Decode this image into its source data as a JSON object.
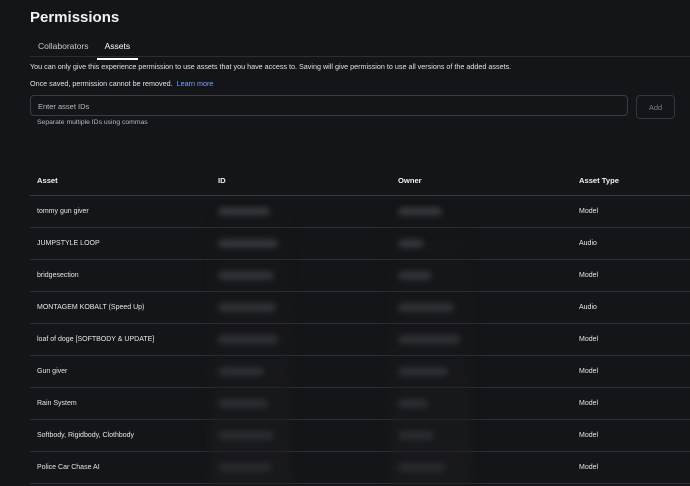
{
  "header": {
    "title": "Permissions"
  },
  "tabs": [
    {
      "label": "Collaborators",
      "active": false
    },
    {
      "label": "Assets",
      "active": true
    }
  ],
  "description": {
    "line1": "You can only give this experience permission to use assets that you have access to. Saving will give permission to use all versions of the added assets.",
    "line2": "Once saved, permission cannot be removed.",
    "learn_more": "Learn more"
  },
  "input": {
    "placeholder": "Enter asset IDs",
    "value": "",
    "hint": "Separate multiple IDs using commas"
  },
  "add_button": {
    "label": "Add",
    "disabled": true
  },
  "table": {
    "columns": [
      "Asset",
      "ID",
      "Owner",
      "Asset Type"
    ],
    "rows": [
      {
        "asset": "tommy gun giver",
        "type": "Model"
      },
      {
        "asset": "JUMPSTYLE LOOP",
        "type": "Audio"
      },
      {
        "asset": "bridgesection",
        "type": "Model"
      },
      {
        "asset": "MONTAGEM KOBALT (Speed Up)",
        "type": "Audio"
      },
      {
        "asset": "loaf of doge [SOFTBODY & UPDATE]",
        "type": "Model"
      },
      {
        "asset": "Gun giver",
        "type": "Model"
      },
      {
        "asset": "Rain System",
        "type": "Model"
      },
      {
        "asset": "Softbody, Rigidbody, Clothbody",
        "type": "Model"
      },
      {
        "asset": "Police Car Chase AI",
        "type": "Model"
      }
    ]
  },
  "colors": {
    "background": "#141518",
    "link": "#7aa5ff",
    "divider": "#2c2e33"
  }
}
